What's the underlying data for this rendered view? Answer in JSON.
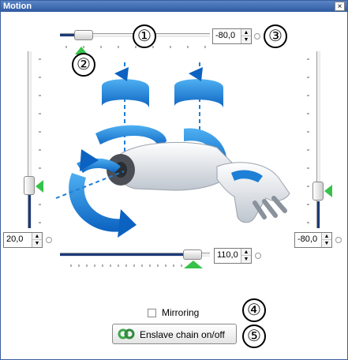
{
  "window": {
    "title": "Motion",
    "close_label": "×"
  },
  "top_slider": {
    "value_text": "-80,0",
    "badge": "①"
  },
  "top_marker": {
    "badge": "②"
  },
  "top_spin": {
    "badge": "③"
  },
  "left_slider": {
    "value_text": "20,0"
  },
  "right_slider": {
    "value_text": "-80,0"
  },
  "bottom_slider": {
    "value_text": "110,0"
  },
  "mirroring": {
    "label": "Mirroring",
    "checked": false,
    "badge": "④"
  },
  "enslave": {
    "label": "Enslave chain on/off",
    "badge": "⑤"
  },
  "spin_arrows": {
    "up": "▲",
    "down": "▼"
  },
  "colors": {
    "accent": "#1c3a78",
    "arrow_blue": "#1e7fd6",
    "marker_green": "#36c24a"
  }
}
